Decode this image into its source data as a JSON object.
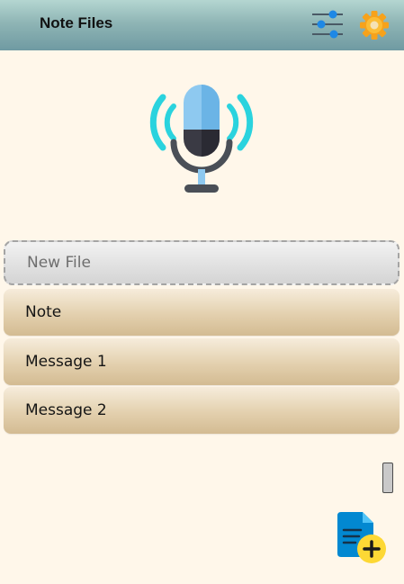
{
  "header": {
    "title": "Note Files",
    "filter_icon": "sliders-icon",
    "settings_icon": "gear-icon"
  },
  "illustration": {
    "icon": "microphone-icon"
  },
  "list": {
    "new_file_label": "New File",
    "items": [
      {
        "label": "Note"
      },
      {
        "label": "Message 1"
      },
      {
        "label": "Message 2"
      }
    ]
  },
  "fab": {
    "icon": "add-file-icon"
  },
  "colors": {
    "background": "#fff7ea",
    "header_top": "#b4d6d1",
    "header_bottom": "#6f9aa2",
    "row_tan": "#e3d0ae",
    "accent_cyan": "#2ad3de",
    "accent_blue": "#1e88e5",
    "accent_yellow": "#fdd835",
    "gear_orange": "#f7a21b"
  }
}
